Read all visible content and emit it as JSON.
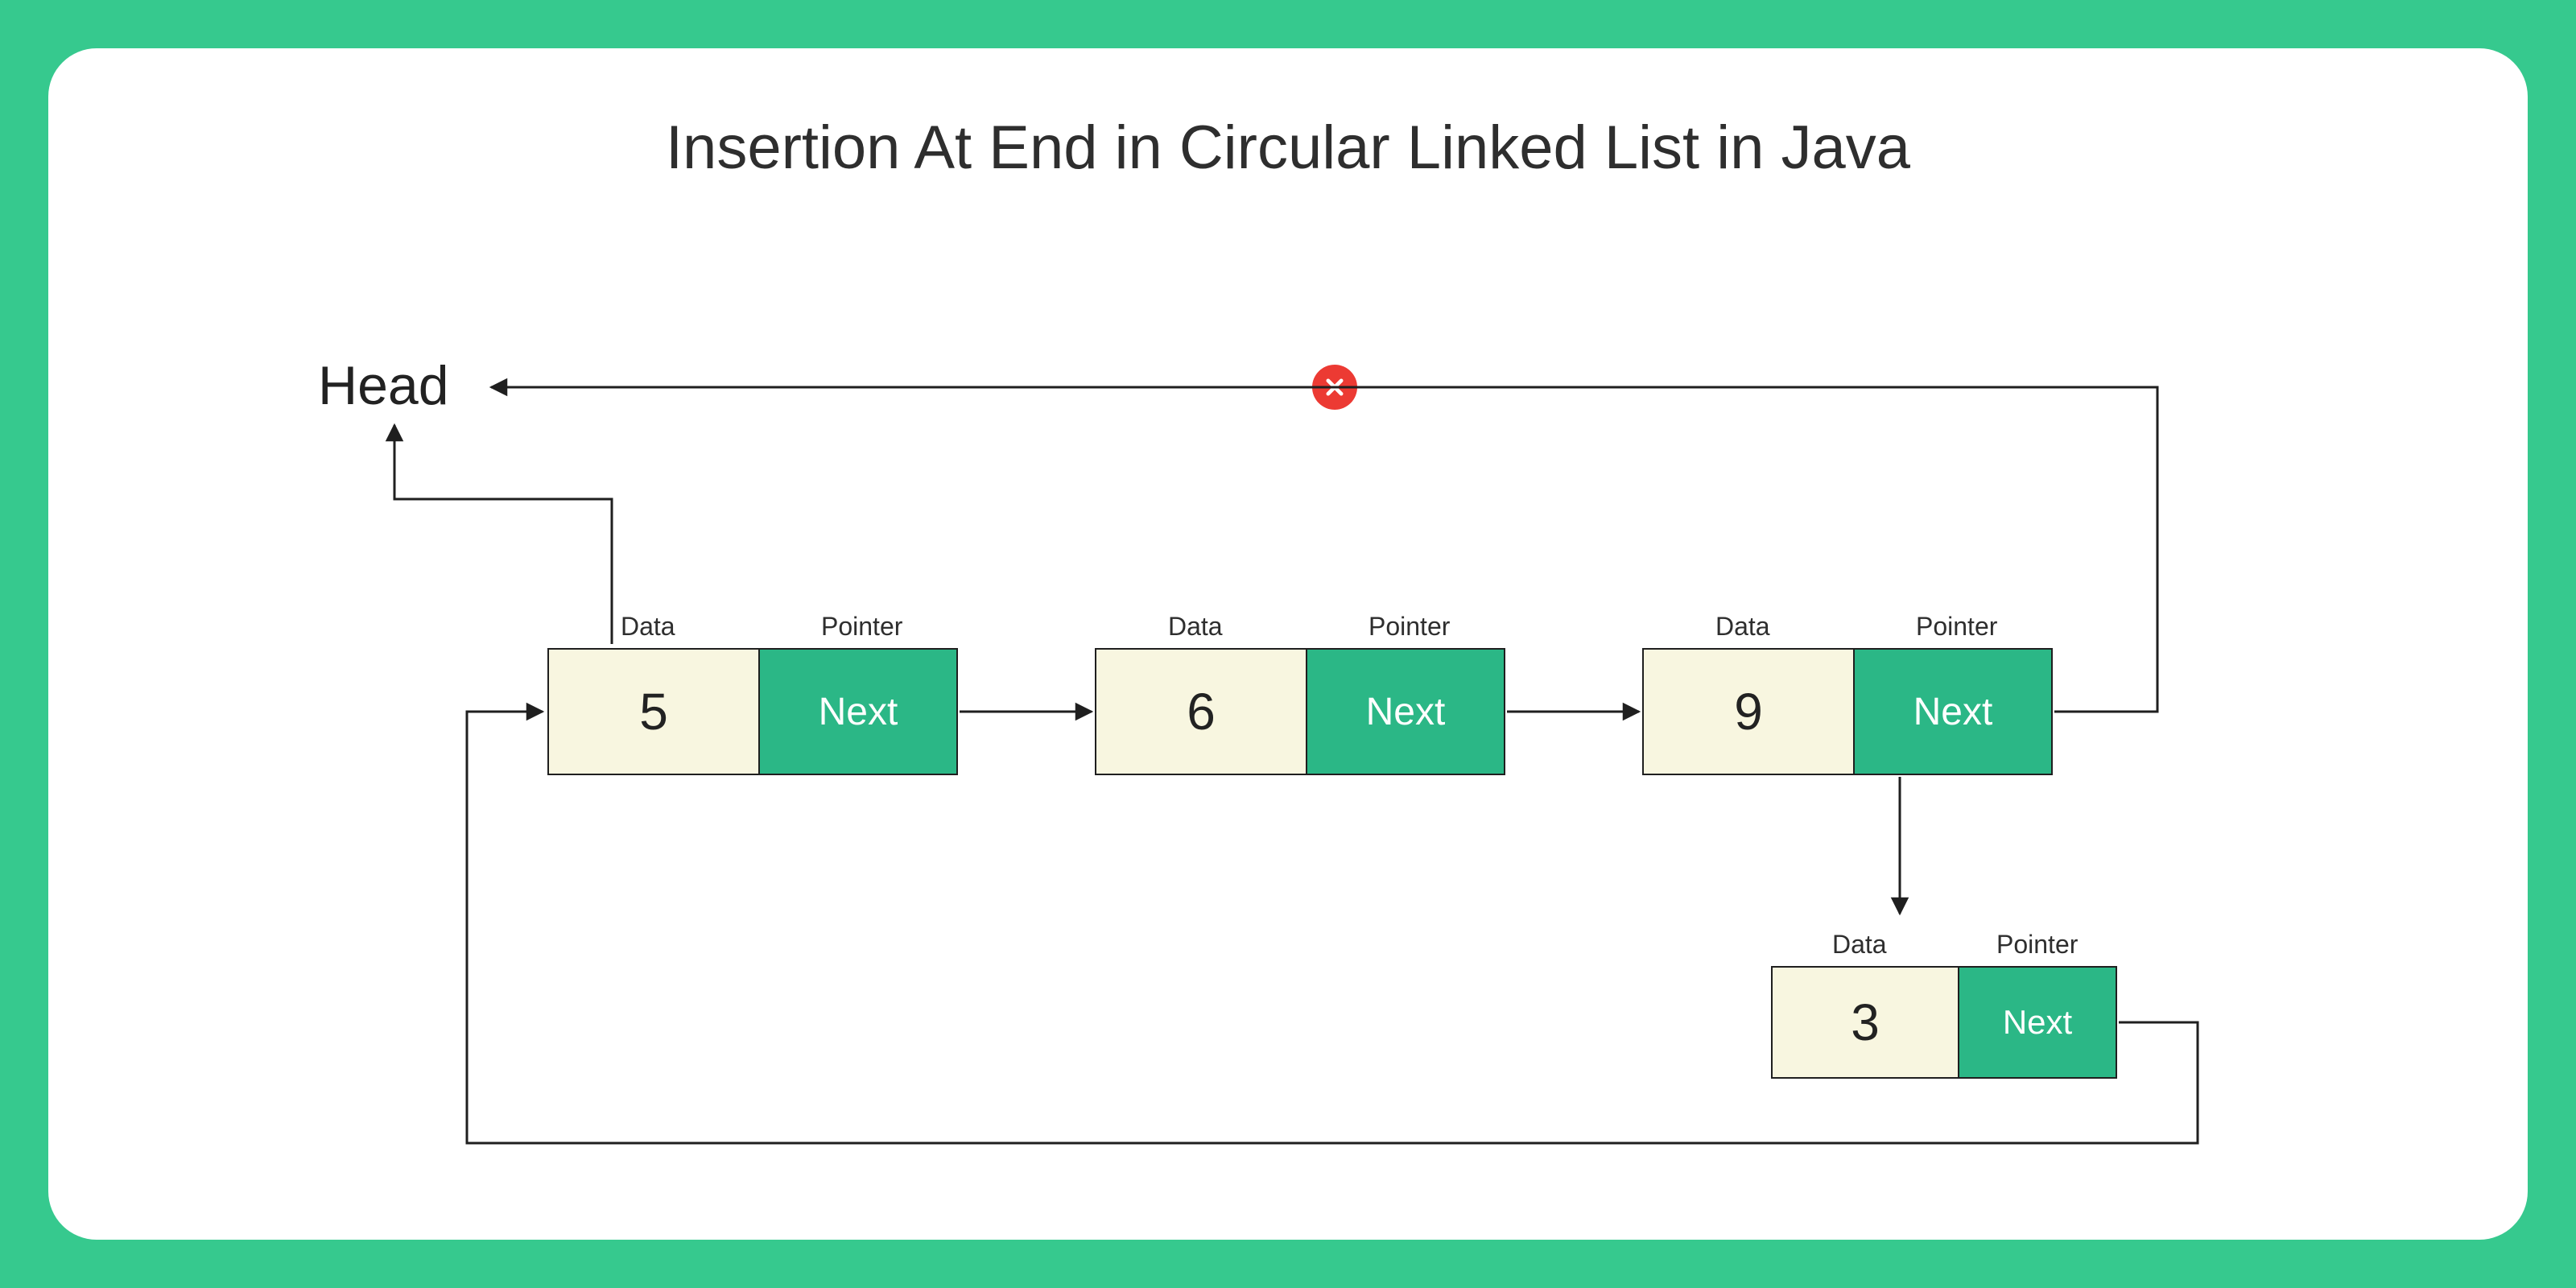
{
  "title": "Insertion At End in Circular Linked List in Java",
  "head_label": "Head",
  "labels": {
    "data": "Data",
    "pointer": "Pointer",
    "next": "Next"
  },
  "colors": {
    "frame": "#36c98e",
    "panel": "#ffffff",
    "node_data_bg": "#f8f6e0",
    "node_ptr_bg": "#2bb786",
    "stroke": "#1f1f1f",
    "error": "#ec3a33"
  },
  "nodes": [
    {
      "value": "5"
    },
    {
      "value": "6"
    },
    {
      "value": "9"
    },
    {
      "value": "3"
    }
  ],
  "break_icon": "close"
}
